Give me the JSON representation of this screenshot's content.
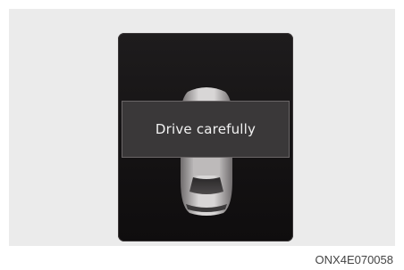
{
  "display": {
    "message": "Drive carefully",
    "vehicle_icon": "car-top-view-icon"
  },
  "figure": {
    "code": "ONX4E070058"
  },
  "colors": {
    "screen_bg": "#141213",
    "popup_bg": "#3a3839",
    "panel_bg": "#ebebeb"
  }
}
